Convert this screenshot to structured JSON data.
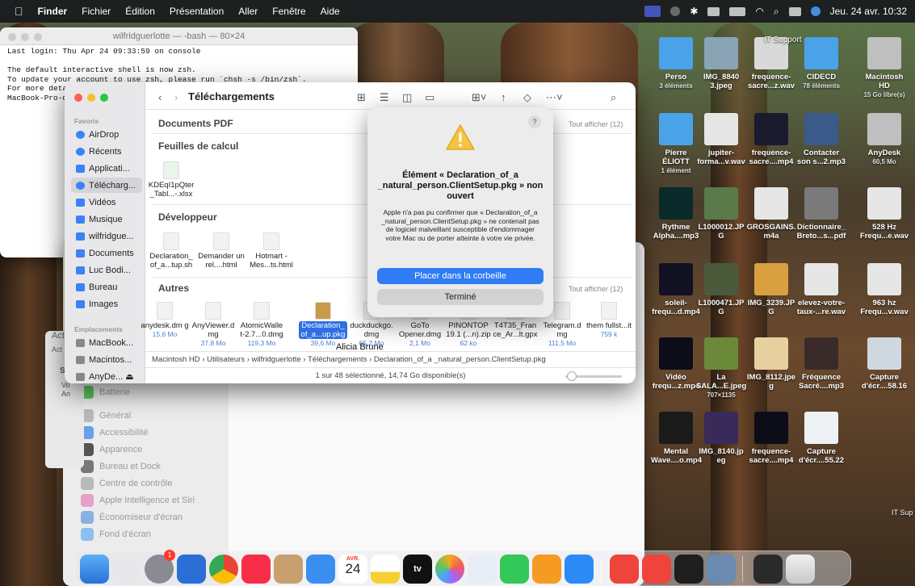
{
  "menubar": {
    "app": "Finder",
    "items": [
      "Fichier",
      "Édition",
      "Présentation",
      "Aller",
      "Fenêtre",
      "Aide"
    ],
    "clock": "Jeu. 24 avr.  10:32"
  },
  "terminal": {
    "title": "wilfridguerlotte — -bash — 80×24",
    "lines": [
      "Last login: Thu Apr 24 09:33:59 on console",
      "",
      "The default interactive shell is now zsh.",
      "To update your account to use zsh, please run `chsh -s /bin/zsh`.",
      "For more deta",
      "MacBook-Pro-d"
    ]
  },
  "finder": {
    "title": "Téléchargements",
    "sidebar": {
      "favoris_header": "Favoris",
      "items": [
        "AirDrop",
        "Récents",
        "Applicati...",
        "Télécharg...",
        "Vidéos",
        "Musique",
        "wilfridgue...",
        "Documents",
        "Luc Bodi...",
        "Bureau",
        "Images"
      ],
      "emplacements_header": "Emplacements",
      "locations": [
        "MacBook...",
        "Macintos...",
        "AnyDe... ⏏"
      ]
    },
    "sections": {
      "pdf": "Documents PDF",
      "calc": "Feuilles de calcul",
      "dev": "Développeur",
      "autres": "Autres"
    },
    "see_all": "Tout afficher (12)",
    "calc_files": [
      {
        "name": "KDEqI1pQter _Tabl...-.xlsx"
      }
    ],
    "dev_files": [
      {
        "name": "Declaration_ of_a...tup.sh"
      },
      {
        "name": "Demander un rel....html"
      },
      {
        "name": "Hotmart - Mes...ts.html"
      }
    ],
    "other_files": [
      {
        "name": "anydesk.dm g",
        "size": "15,6 Mo"
      },
      {
        "name": "AnyViewer.d mg",
        "size": "37,8 Mo"
      },
      {
        "name": "AtomicWalle t-2.7...0.dmg",
        "size": "119,3 Mo"
      },
      {
        "name": "Declaration_ of_a...up.pkg",
        "size": "39,6 Mo"
      },
      {
        "name": "duckduckgo. dmg",
        "size": "65,2 Mo"
      },
      {
        "name": "GoTo Opener.dmg",
        "size": "2,1 Mo"
      },
      {
        "name": "PINONTOP 19.1 (...n).zip",
        "size": "62 ko"
      },
      {
        "name": "T4T35_Fran ce_Ar...lt.gpx",
        "size": ""
      },
      {
        "name": "Telegram.d mg",
        "size": "111,5 Mo"
      },
      {
        "name": "them fullst...it",
        "size": "759 k"
      }
    ],
    "drag_label": "Alicia Brune",
    "path": "Macintosh HD › Utilisateurs › wilfridguerlotte › Téléchargements › Declaration_of_a _natural_person.ClientSetup.pkg",
    "status": "1 sur 48 sélectionné, 14,74 Go disponible(s)"
  },
  "alert": {
    "help": "?",
    "title": "Élément « Declaration_of_a _natural_person.ClientSetup.pkg » non ouvert",
    "message": "Apple n'a pas pu confirmer que « Declaration_of_a _natural_person.ClientSetup.pkg » ne contenait pas de logiciel malveillant susceptible d'endommager votre Mac ou de porter atteinte à votre vie privée.",
    "primary": "Placer dans la corbeille",
    "secondary": "Terminé"
  },
  "settings": {
    "items": [
      "Batterie",
      "Général",
      "Accessibilité",
      "Apparence",
      "Bureau et Dock",
      "Centre de contrôle",
      "Apple Intelligence et Siri",
      "Économiseur d'écran",
      "Fond d'écran"
    ]
  },
  "behind": {
    "act1": "Act",
    "act2": "Act",
    "vo": "Vo",
    "an": "An"
  },
  "desktop": [
    {
      "label": "Perso",
      "sub": "3 éléments",
      "color": "#4aa3e8"
    },
    {
      "label": "IMG_8840 3.jpeg",
      "sub": "",
      "color": "#8aa3b5"
    },
    {
      "label": "frequence- sacre...z.wav",
      "sub": "",
      "color": "#d9d9d9"
    },
    {
      "label": "CIDECD",
      "sub": "78 éléments",
      "color": "#4aa3e8"
    },
    {
      "label": "Macintosh HD",
      "sub": "15 Go libre(s)",
      "color": "#bfbfbf"
    },
    {
      "label": "Pierre ÉLIOTT",
      "sub": "1 élément",
      "color": "#4aa3e8"
    },
    {
      "label": "jupiter- forma...v.wav",
      "sub": "",
      "color": "#e6e6e6"
    },
    {
      "label": "frequence- sacre....mp4",
      "sub": "",
      "color": "#1a1a2e"
    },
    {
      "label": "Contacter son s...2.mp3",
      "sub": "",
      "color": "#3a5a8a"
    },
    {
      "label": "AnyDesk",
      "sub": "60,5 Mo",
      "color": "#bfbfbf"
    },
    {
      "label": "Rythme Alpha....mp3",
      "sub": "",
      "color": "#0b2a2a"
    },
    {
      "label": "L1000012.JP G",
      "sub": "",
      "color": "#5a7a4a"
    },
    {
      "label": "GROSGAINS. m4a",
      "sub": "",
      "color": "#e6e6e6"
    },
    {
      "label": "Dictionnaire_ Breto...s...pdf",
      "sub": "",
      "color": "#7a7a7a"
    },
    {
      "label": "528 Hz Frequ...e.wav",
      "sub": "",
      "color": "#e6e6e6"
    },
    {
      "label": "soleil- frequ...d.mp4",
      "sub": "",
      "color": "#111122"
    },
    {
      "label": "L1000471.JP G",
      "sub": "",
      "color": "#4a5a3a"
    },
    {
      "label": "IMG_3239.JP G",
      "sub": "",
      "color": "#d8a040"
    },
    {
      "label": "elevez-votre- taux-...re.wav",
      "sub": "",
      "color": "#e6e6e6"
    },
    {
      "label": "963 hz Frequ...v.wav",
      "sub": "",
      "color": "#e6e6e6"
    },
    {
      "label": "Vidéo frequ...z.mp4",
      "sub": "",
      "color": "#0d0d1a"
    },
    {
      "label": "La SALA...E.jpeg",
      "sub": "707×1135",
      "color": "#6a8a3a"
    },
    {
      "label": "IMG_8112.jpe g",
      "sub": "",
      "color": "#e6d0a0"
    },
    {
      "label": "Fréquence Sacré....mp3",
      "sub": "",
      "color": "#3a2a2a"
    },
    {
      "label": "Capture d'écr....58.16",
      "sub": "",
      "color": "#cfd8e0"
    },
    {
      "label": "Mental Wave....o.mp4",
      "sub": "",
      "color": "#1a1a1a"
    },
    {
      "label": "IMG_8140.jp eg",
      "sub": "",
      "color": "#3a2a5a"
    },
    {
      "label": "frequence- sacre....mp4",
      "sub": "",
      "color": "#0d0d1a"
    },
    {
      "label": "Capture d'écr....55.22",
      "sub": "",
      "color": "#eef2f5"
    }
  ],
  "desktop_extra": {
    "it_support": "IT Support",
    "it_sup": "IT Sup"
  },
  "dock": {
    "calendar_month": "AVR.",
    "calendar_day": "24",
    "badge": "1",
    "tv": "tv"
  }
}
